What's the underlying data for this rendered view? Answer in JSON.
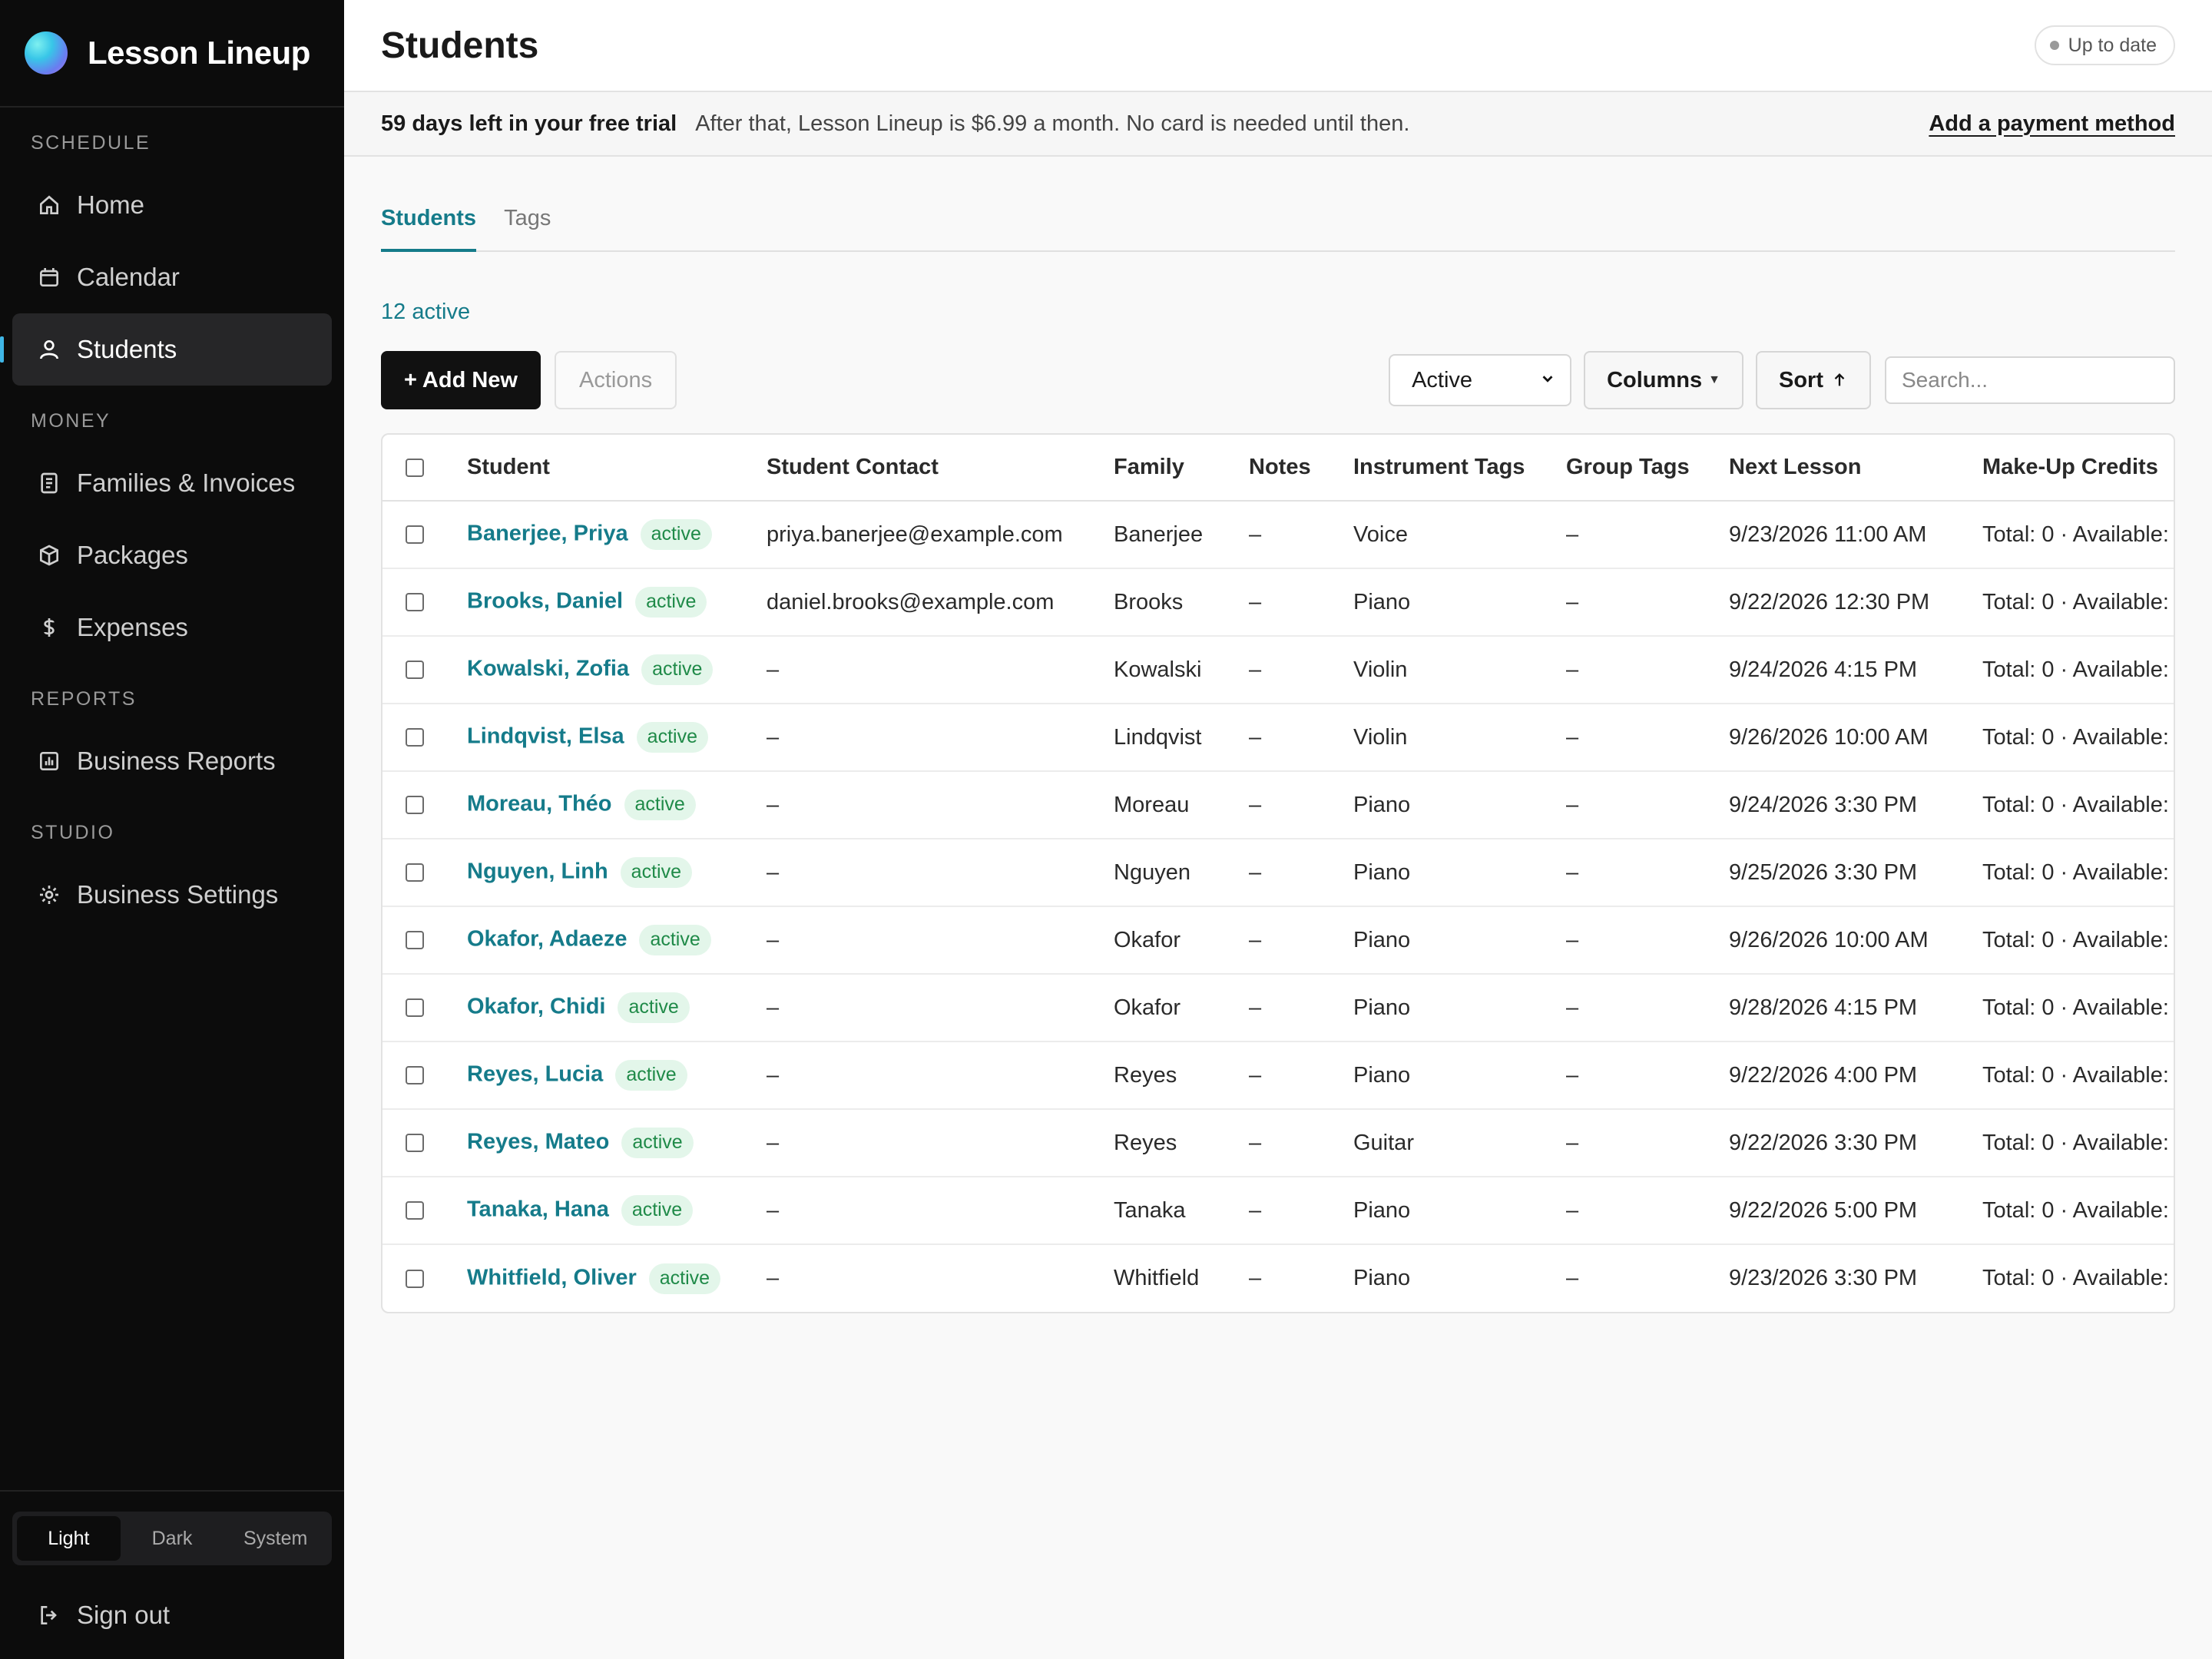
{
  "app": {
    "name": "Lesson Lineup"
  },
  "sidebar": {
    "sections": [
      {
        "label": "SCHEDULE",
        "items": [
          {
            "label": "Home",
            "icon": "home-icon"
          },
          {
            "label": "Calendar",
            "icon": "calendar-icon"
          },
          {
            "label": "Students",
            "icon": "user-icon",
            "active": true
          }
        ]
      },
      {
        "label": "MONEY",
        "items": [
          {
            "label": "Families & Invoices",
            "icon": "invoice-icon"
          },
          {
            "label": "Packages",
            "icon": "package-icon"
          },
          {
            "label": "Expenses",
            "icon": "dollar-icon"
          }
        ]
      },
      {
        "label": "REPORTS",
        "items": [
          {
            "label": "Business Reports",
            "icon": "chart-icon"
          }
        ]
      },
      {
        "label": "STUDIO",
        "items": [
          {
            "label": "Business Settings",
            "icon": "gear-icon"
          }
        ]
      }
    ],
    "theme": {
      "options": [
        "Light",
        "Dark",
        "System"
      ],
      "selected": "Light"
    },
    "signout_label": "Sign out"
  },
  "header": {
    "title": "Students",
    "status": "Up to date"
  },
  "trial": {
    "headline": "59 days left in your free trial",
    "message": "After that, Lesson Lineup is $6.99 a month. No card is needed until then.",
    "link": "Add a payment method"
  },
  "tabs": [
    {
      "label": "Students",
      "active": true
    },
    {
      "label": "Tags",
      "active": false
    }
  ],
  "count_label": "12 active",
  "toolbar": {
    "add_label": "+ Add New",
    "actions_label": "Actions",
    "filter_value": "Active",
    "columns_label": "Columns",
    "sort_label": "Sort",
    "search_placeholder": "Search..."
  },
  "table": {
    "columns": [
      "Student",
      "Student Contact",
      "Family",
      "Notes",
      "Instrument Tags",
      "Group Tags",
      "Next Lesson",
      "Make-Up Credits"
    ],
    "rows": [
      {
        "student": "Banerjee, Priya",
        "status": "active",
        "contact": "priya.banerjee@example.com",
        "family": "Banerjee",
        "notes": "–",
        "instrument": "Voice",
        "group": "–",
        "next": "9/23/2026 11:00 AM",
        "credits": "Total: 0 · Available:"
      },
      {
        "student": "Brooks, Daniel",
        "status": "active",
        "contact": "daniel.brooks@example.com",
        "family": "Brooks",
        "notes": "–",
        "instrument": "Piano",
        "group": "–",
        "next": "9/22/2026 12:30 PM",
        "credits": "Total: 0 · Available:"
      },
      {
        "student": "Kowalski, Zofia",
        "status": "active",
        "contact": "–",
        "family": "Kowalski",
        "notes": "–",
        "instrument": "Violin",
        "group": "–",
        "next": "9/24/2026 4:15 PM",
        "credits": "Total: 0 · Available:"
      },
      {
        "student": "Lindqvist, Elsa",
        "status": "active",
        "contact": "–",
        "family": "Lindqvist",
        "notes": "–",
        "instrument": "Violin",
        "group": "–",
        "next": "9/26/2026 10:00 AM",
        "credits": "Total: 0 · Available:"
      },
      {
        "student": "Moreau, Théo",
        "status": "active",
        "contact": "–",
        "family": "Moreau",
        "notes": "–",
        "instrument": "Piano",
        "group": "–",
        "next": "9/24/2026 3:30 PM",
        "credits": "Total: 0 · Available:"
      },
      {
        "student": "Nguyen, Linh",
        "status": "active",
        "contact": "–",
        "family": "Nguyen",
        "notes": "–",
        "instrument": "Piano",
        "group": "–",
        "next": "9/25/2026 3:30 PM",
        "credits": "Total: 0 · Available:"
      },
      {
        "student": "Okafor, Adaeze",
        "status": "active",
        "contact": "–",
        "family": "Okafor",
        "notes": "–",
        "instrument": "Piano",
        "group": "–",
        "next": "9/26/2026 10:00 AM",
        "credits": "Total: 0 · Available:"
      },
      {
        "student": "Okafor, Chidi",
        "status": "active",
        "contact": "–",
        "family": "Okafor",
        "notes": "–",
        "instrument": "Piano",
        "group": "–",
        "next": "9/28/2026 4:15 PM",
        "credits": "Total: 0 · Available:"
      },
      {
        "student": "Reyes, Lucia",
        "status": "active",
        "contact": "–",
        "family": "Reyes",
        "notes": "–",
        "instrument": "Piano",
        "group": "–",
        "next": "9/22/2026 4:00 PM",
        "credits": "Total: 0 · Available:"
      },
      {
        "student": "Reyes, Mateo",
        "status": "active",
        "contact": "–",
        "family": "Reyes",
        "notes": "–",
        "instrument": "Guitar",
        "group": "–",
        "next": "9/22/2026 3:30 PM",
        "credits": "Total: 0 · Available:"
      },
      {
        "student": "Tanaka, Hana",
        "status": "active",
        "contact": "–",
        "family": "Tanaka",
        "notes": "–",
        "instrument": "Piano",
        "group": "–",
        "next": "9/22/2026 5:00 PM",
        "credits": "Total: 0 · Available:"
      },
      {
        "student": "Whitfield, Oliver",
        "status": "active",
        "contact": "–",
        "family": "Whitfield",
        "notes": "–",
        "instrument": "Piano",
        "group": "–",
        "next": "9/23/2026 3:30 PM",
        "credits": "Total: 0 · Available:"
      }
    ]
  },
  "colors": {
    "accent": "#157b8a",
    "sidebar_bg": "#0c0c0c",
    "badge_bg": "#e3f6ea",
    "badge_text": "#1f8a48",
    "active_indicator": "#3fb6e6"
  }
}
